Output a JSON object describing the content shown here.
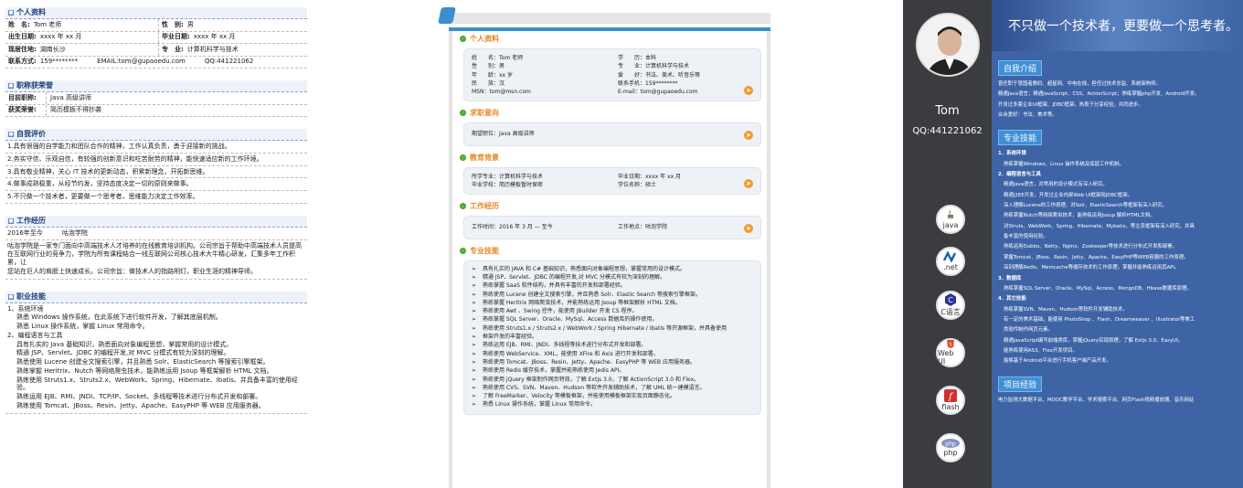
{
  "panel1": {
    "personal": {
      "title": "个人资料",
      "rows": [
        {
          "k1": "姓　名:",
          "v1": "Tom 老师",
          "k2": "性　别:",
          "v2": "男"
        },
        {
          "k1": "出生日期:",
          "v1": "xxxx 年 xx 月",
          "k2": "毕业日期:",
          "v2": "xxxx 年 xx 月"
        },
        {
          "k1": "现居住地:",
          "v1": "湖南长沙",
          "k2": "专　业:",
          "v2": "计算机科学与技术"
        }
      ],
      "contact": {
        "k": "联系方式:",
        "v": "159********　　　EMAIL:tom@gupaoedu.com　　　QQ:441221062"
      }
    },
    "honor": {
      "title": "职称获荣誉",
      "rows": [
        {
          "k": "目前职称:",
          "v": "Java 高级讲师"
        },
        {
          "k": "获奖荣誉:",
          "v": "简历模板不得抄袭"
        }
      ]
    },
    "evaluation": {
      "title": "自我评价",
      "lines": [
        "1.具有很强的自学能力和团队合作的精神，工作认真负责，勇于迎接新的挑战。",
        "2.务实守信、乐观自信，有较强的创新意识和吃苦耐劳的精神，能快速适应新的工作环境。",
        "3.具有敬业精神，关心 IT 技术的更新动态，积累新理念，开拓新思维。",
        "4.做事成熟稳重，从经节约发，坚持态度决定一切的原则来做事。",
        "5.不只做一个技术者，更要做一个思考者，思维能力决定工作效率。"
      ]
    },
    "work": {
      "title": "工作经历",
      "header": "2016年至今　　　咕泡学院",
      "lines": [
        "咕泡学院是一家专门面向中高端技术人才培养的在线教育培训机构。公司宗旨于帮助中高端技术人员提高",
        "在互联网行业的竞争力，学院为所有课程结合一线互联网公司核心技术大牛精心研发，汇集多年工作积累，让",
        "您站在巨人的肩膀上快速成长。公司宗旨：做技术人的指路明灯，职业生涯的精神导师。"
      ]
    },
    "skills": {
      "title": "职业技能",
      "lines": [
        {
          "t": "1、系统环境",
          "ind": false
        },
        {
          "t": "熟悉 Windows 操作系统，在此系统下进行软件开发，了解其底层机制。",
          "ind": true
        },
        {
          "t": "熟悉 Linux 操作系统，掌握 Linux 常用命令。",
          "ind": true
        },
        {
          "t": "2、编程语言与工具",
          "ind": false
        },
        {
          "t": "具有扎实的 Java 基础知识，熟悉面向对象编程思想，掌握常用的设计模式。",
          "ind": true
        },
        {
          "t": "精通 JSP、Servlet、JDBC 的编程开发,对 MVC 分模式有较为深刻的理解。",
          "ind": true
        },
        {
          "t": "熟悉使用 Lucene 创建全文搜索引擎，并且熟悉 Solr、ElasticSearch 等搜索引擎框架。",
          "ind": true
        },
        {
          "t": "熟练掌握 Heritrix、Nutch 等网络爬虫技术，能熟练运用 Jsoup 等框架解析 HTML 文档。",
          "ind": true
        },
        {
          "t": "熟练使用 Struts1.x、Struts2.x、WebWork、Spring、Hibernate、Ibatis、并具备丰富的使用经验。",
          "ind": true
        },
        {
          "t": "熟练运用 EJB、RMI、JNDI、TCP/IP、Socket、多线程等技术进行分布式开发和部署。",
          "ind": true
        },
        {
          "t": "熟练使用 Tomcat、JBoss、Resin、Jetty、Apache、EasyPHP 等 WEB 应用服务器。",
          "ind": true
        }
      ]
    }
  },
  "panel2": {
    "personal": {
      "title": "个人资料",
      "rows": [
        [
          "姓　　名：Tom 老师",
          "学　　历：本科"
        ],
        [
          "性　　别：男",
          "专　　业：计算机科学与技术"
        ],
        [
          "年　　龄：xx 岁",
          "爱　　好：书法、美术、听音乐等"
        ],
        [
          "民　　族：汉",
          "联系手机：159********"
        ],
        [
          "MSN：tom@msn.com",
          "E-mail：tom@gupaoedu.com"
        ]
      ]
    },
    "intent": {
      "title": "求职意向",
      "text": "期望职位：Java 高级讲师"
    },
    "education": {
      "title": "教育背景",
      "rows": [
        [
          "所学专业：计算机科学与技术",
          "毕业日期：xxxx 年 xx 月"
        ],
        [
          "毕业学校：简历模板暂时保密",
          "学位名称：硕士"
        ]
      ]
    },
    "work": {
      "title": "工作经历",
      "row": [
        "工作时间：2016 年 3 月 — 至今",
        "工作地点：咕泡学院"
      ]
    },
    "skills": {
      "title": "专业技能",
      "items": [
        "具有扎实的 JAVA 和 C# 基础知识，熟悉面向对象编程思想，掌握常用的设计模式。",
        "精通 JSP、Servlet、JDBC 的编程开发,对 MVC 分模式有较为深刻的理解。",
        "熟练掌握 SaaS 软件结构，并具有丰富的开发和部署经验。",
        "熟练使用 Lucene 创建全文搜索引擎，并且熟悉 Solr、Elastic Search 等搜索引擎框架。",
        "熟练掌握 Heritrix 网络爬虫技术，并能熟练运用 Jsoup 等框架解析 HTML 文档。",
        "熟练使用 Awt 、Swing 控件，能使用 JBuilder 开发 CS 程序。",
        "熟练掌握 SQL Server、Oracle、MySql、Access 数据库的操作使用。",
        "熟练使用 Struts1.x / Struts2.x / WebWork / Spring Hibernate / Ibatis 等开源框架，并具备使用",
        "框架开发的丰富经验。",
        "熟练运用 EJB、RMI、JNDI、多线程等技术进行分布式开发和部署。",
        "熟练使用 WebService、XML，能使用 XFire 和 Axis 进行开发和部署。",
        "熟练使用 Tomcat、JBoss、Resin、Jetty、Apache、EasyPHP 等 WEB 应用服务器。",
        "熟练使用 Redis 缓存技术，掌握并能熟练使用 Jedis API。",
        "熟练使用 jQuery 框架制作网页特效，了解 Extjs 3.0，了解 ActionScript 3.0 和 Flex。",
        "熟练使用 CVS、SVN、Maven、Hudson 等软件开发辅助技术，了解 UML 统一建模语言。",
        "了解 FreeMarker、Velocity 等模板框架，并能使用模板框架实现页面静态化。",
        "熟悉 Linux 操作系统，掌握 Linux 常用命令。"
      ]
    }
  },
  "panel3": {
    "name": "Tom",
    "qq": "QQ:441221062",
    "banner": "不只做一个技术者，更要做一个思考者。",
    "icons": [
      "java",
      ".net",
      "C语言",
      "Web UI",
      "flash",
      "php"
    ],
    "intro": {
      "title": "自我介绍",
      "lines": [
        "曾任职于慧国者教码、超星网、中电在线，担任过技术总监、系统架构师。",
        "精通Java语言；精通JavaScript、CSS、ActionScript；熟练掌握php开发、Android开发。",
        "开发过多套企业UI框架、JDBC框架。热衷于分享经验，共同进步。",
        "业余爱好：书法、美术等。"
      ]
    },
    "skills": {
      "title": "专业技能",
      "lines": [
        {
          "t": "1．系统环境",
          "b": true,
          "i": false
        },
        {
          "t": "熟练掌握Windows、Linux 操作系统及底层工作机制。",
          "b": false,
          "i": true
        },
        {
          "t": "2．编程语言与工具",
          "b": true,
          "i": false
        },
        {
          "t": "精通Java语言，对常用的设计模式有深入研究。",
          "b": false,
          "i": true
        },
        {
          "t": "精通J2EE开发，开发过企业内部Web UI框架和JDBC框架。",
          "b": false,
          "i": true
        },
        {
          "t": "深入理解Lucene的工作原理，对Solr、ElasticSearch等框架有深入研究。",
          "b": false,
          "i": true
        },
        {
          "t": "熟练掌握Nutch等网络爬虫技术，能熟练运用Jsoup 解析HTML文档。",
          "b": false,
          "i": true
        },
        {
          "t": "对Struts、WebWork、Spring、Hibernate、Mybatis，等主流框架有深入研究，并具",
          "b": false,
          "i": true
        },
        {
          "t": "备丰富的使用经验。",
          "b": false,
          "i": true
        },
        {
          "t": "熟练运用Dubbo、Netty、Nginx、Zookeeper等技术进行分布式开发和部署。",
          "b": false,
          "i": true
        },
        {
          "t": "掌握Tomcat、JBoss、Resin、Jetty、Apache、EasyPHP等WEB容器的工作原理。",
          "b": false,
          "i": true
        },
        {
          "t": "深刻理解Redis、Memcache等缓存技术的工作原理，掌握并能熟练运用其API。",
          "b": false,
          "i": true
        },
        {
          "t": "3．数据库",
          "b": true,
          "i": false
        },
        {
          "t": "熟练掌握SQL Server、Oracle、MySql、Access、MongoDB、Hbase数据库原理。",
          "b": false,
          "i": true
        },
        {
          "t": "4．其它技能",
          "b": true,
          "i": false
        },
        {
          "t": "熟练掌握SVN、Maven、Hudson等软件开发辅助技术。",
          "b": false,
          "i": true
        },
        {
          "t": "有一定的美术基础，能使用 PhotoShop 、Flash、Dreamweaver 、Illustrator等美工",
          "b": false,
          "i": true
        },
        {
          "t": "类软件制作网页元素。",
          "b": false,
          "i": true
        },
        {
          "t": "精通JavaScript编写前端类库，掌握jQuery实现原理，了解 ExtJs 3.0、EasyUI。",
          "b": false,
          "i": true
        },
        {
          "t": "能熟练使用AS3、Flex开发项目。",
          "b": false,
          "i": true
        },
        {
          "t": "能够基于Android平台进行手机客户端产品开发。",
          "b": false,
          "i": true
        }
      ]
    },
    "projects": {
      "title": "项目经验",
      "text": "电力监测大数据平台、MOOC教学平台、学术搜索平台、网页Flash视频播放器、音乐网站"
    }
  }
}
